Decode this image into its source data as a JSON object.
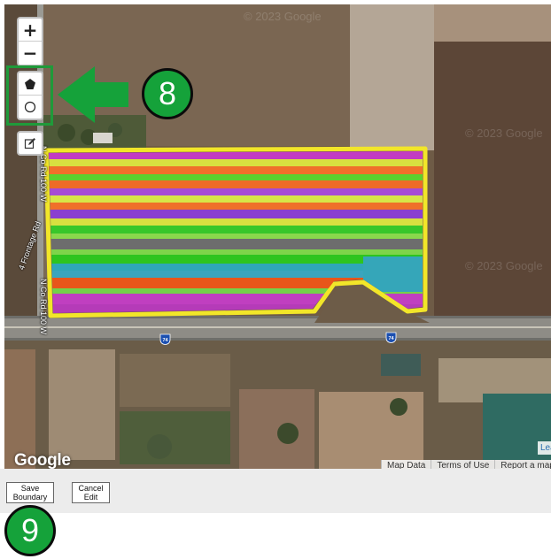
{
  "map": {
    "zoom_in_label": "+",
    "zoom_out_label": "−",
    "google_logo": "Google",
    "watermark": "© 2023 Google",
    "leaflet_label": "Lea",
    "attribution": {
      "map_data": "Map Data",
      "terms": "Terms of Use",
      "report": "Report a map e"
    },
    "road_labels": {
      "north_road": "N Co Rd 100 W",
      "west_road": "N Co Rd 100 W",
      "frontage": "4 Frontage Rd"
    },
    "highway": "74",
    "boundary_color": "#f2e629"
  },
  "annotations": {
    "step_8": "8",
    "step_9": "9",
    "accent_color": "#15a23a"
  },
  "form": {
    "save_line1": "Save",
    "save_line2": "Boundary",
    "cancel_line1": "Cancel",
    "cancel_line2": "Edit"
  }
}
